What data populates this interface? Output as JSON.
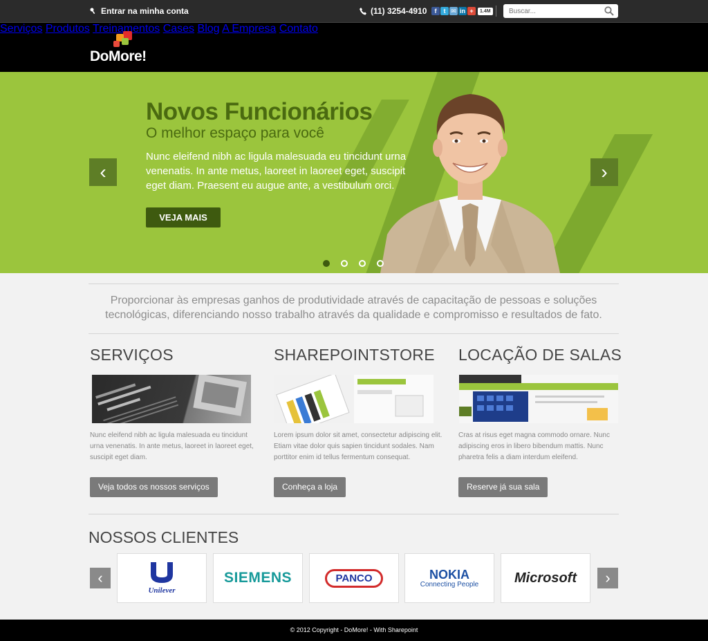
{
  "topbar": {
    "login_label": "Entrar na minha conta",
    "phone": "(11) 3254-4910",
    "social_count": "1.4M",
    "search_placeholder": "Buscar..."
  },
  "brand": {
    "name": "DoMore!"
  },
  "nav": {
    "items": [
      {
        "label": "Serviços"
      },
      {
        "label": "Produtos"
      },
      {
        "label": "Treinamentos"
      },
      {
        "label": "Cases"
      },
      {
        "label": "Blog"
      },
      {
        "label": "A Empresa"
      },
      {
        "label": "Contato"
      }
    ]
  },
  "hero": {
    "title": "Novos Funcionários",
    "subtitle": "O melhor espaço para você",
    "text": "Nunc eleifend nibh ac ligula malesuada eu tincidunt urna venenatis. In ante metus, laoreet in laoreet eget, suscipit eget diam. Praesent eu augue ante, a vestibulum orci.",
    "button": "VEJA MAIS",
    "prev": "‹",
    "next": "›",
    "slides_total": 4,
    "active_slide": 1
  },
  "tagline": "Proporcionar às empresas ganhos de produtividade através de capacitação de pessoas e soluções tecnológicas, diferenciando nosso trabalho através da qualidade e compromisso e resultados de fato.",
  "sections": [
    {
      "title": "SERVIÇOS",
      "text": "Nunc eleifend nibh ac ligula malesuada eu tincidunt urna venenatis. In ante metus, laoreet in laoreet eget, suscipit eget diam.",
      "button": "Veja todos os nossos serviços"
    },
    {
      "title": "SHAREPOINTSTORE",
      "text": "Lorem ipsum dolor sit amet, consectetur adipiscing elit. Etiam vitae dolor quis sapien tincidunt sodales. Nam porttitor enim id tellus fermentum consequat.",
      "button": "Conheça a loja"
    },
    {
      "title": "LOCAÇÃO DE SALAS",
      "text": "Cras at risus eget magna commodo ornare. Nunc adipiscing eros in libero bibendum mattis. Nunc pharetra felis a diam interdum eleifend.",
      "button": "Reserve já sua sala"
    }
  ],
  "clients": {
    "title": "NOSSOS CLIENTES",
    "prev": "‹",
    "next": "›",
    "logos": [
      {
        "name": "Unilever"
      },
      {
        "name": "SIEMENS"
      },
      {
        "name": "PANCO"
      },
      {
        "name": "NOKIA",
        "tagline": "Connecting People"
      },
      {
        "name": "Microsoft"
      }
    ]
  },
  "footer": {
    "text": "© 2012 Copyright - DoMore! - With Sharepoint"
  },
  "colors": {
    "hero_green": "#9bc53d",
    "dark_green": "#4a6a10",
    "button_green": "#3e5a0f",
    "header_black": "#000000",
    "topbar": "#2b2b2b"
  }
}
